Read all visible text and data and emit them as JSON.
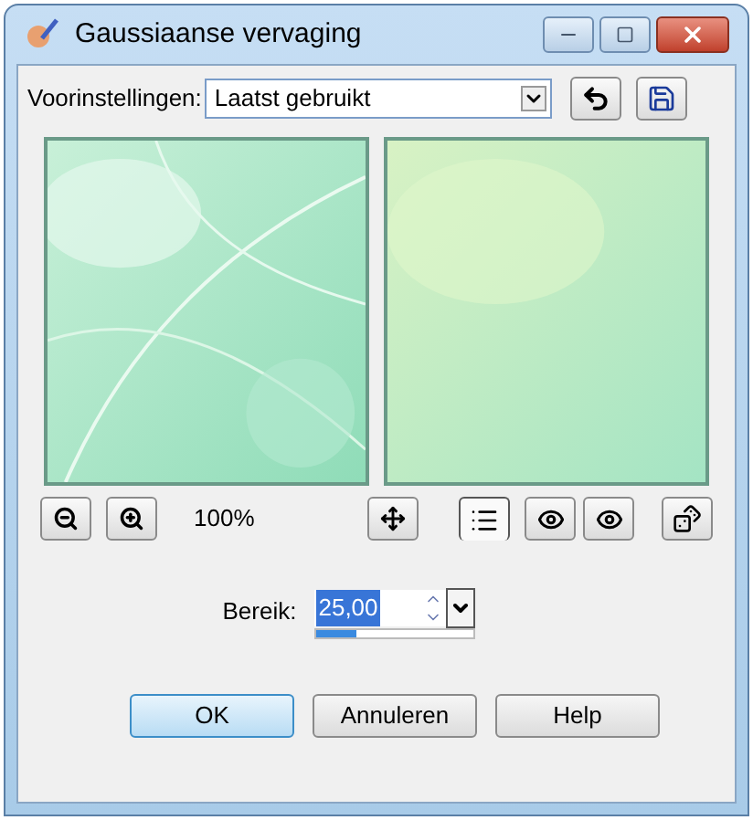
{
  "window": {
    "title": "Gaussiaanse vervaging"
  },
  "presets": {
    "label": "Voorinstellingen:",
    "value": "Laatst gebruikt"
  },
  "zoom": {
    "value": "100%"
  },
  "proof_toggle": {
    "selected": true
  },
  "range": {
    "label": "Bereik:",
    "value": "25,00",
    "level": 0.25
  },
  "buttons": [
    {
      "label": "OK",
      "kind": "default"
    },
    {
      "label": "Annuleren",
      "kind": "normal"
    },
    {
      "label": "Help",
      "kind": "normal"
    }
  ]
}
